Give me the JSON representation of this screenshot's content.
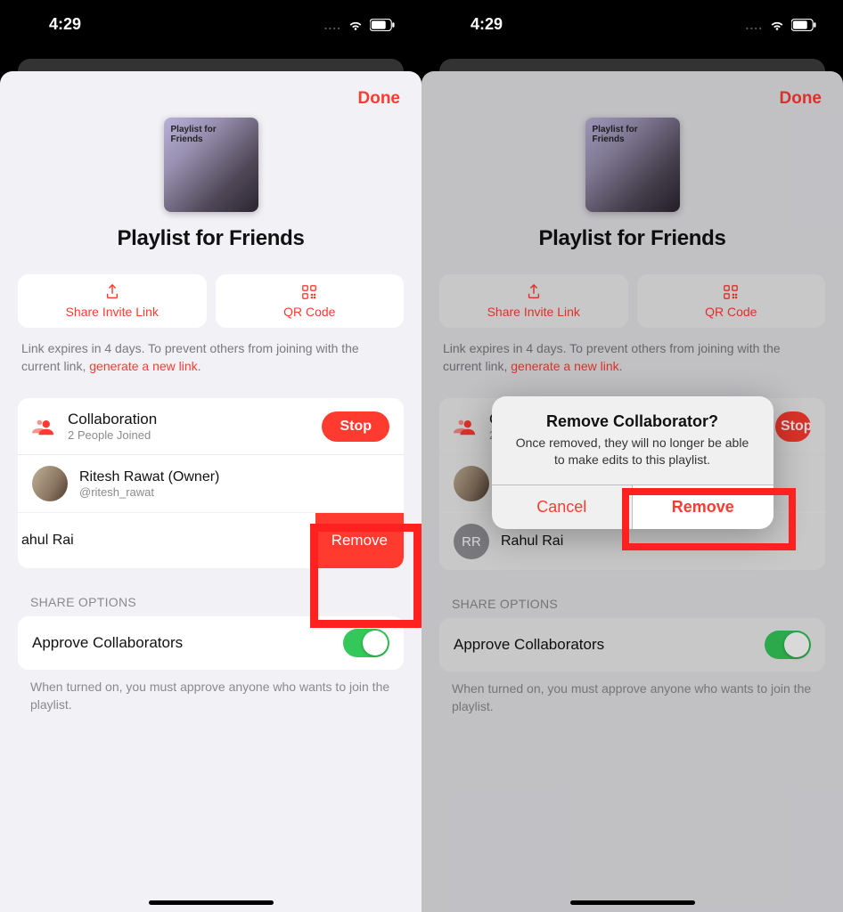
{
  "status": {
    "time": "4:29",
    "dots": "...."
  },
  "sheet": {
    "done": "Done",
    "artwork_label": "Playlist for Friends",
    "title": "Playlist for Friends",
    "share_link_label": "Share Invite Link",
    "qr_label": "QR Code",
    "help_prefix": "Link expires in 4 days. To prevent others from joining with the current link, ",
    "help_link": "generate a new link",
    "help_suffix": ".",
    "collab": {
      "title": "Collaboration",
      "subtitle": "2 People Joined",
      "stop": "Stop"
    },
    "owner": {
      "name": "Ritesh Rawat (Owner)",
      "handle": "@ritesh_rawat"
    },
    "member_swiped": {
      "name_partial": "ahul Rai",
      "remove": "Remove"
    },
    "member_full": {
      "initials": "RR",
      "name": "Rahul Rai"
    },
    "section_label": "SHARE OPTIONS",
    "toggle_label": "Approve Collaborators",
    "footer": "When turned on, you must approve anyone who wants to join the playlist."
  },
  "alert": {
    "title": "Remove Collaborator?",
    "message": "Once removed, they will no longer be able to make edits to this playlist.",
    "cancel": "Cancel",
    "confirm": "Remove"
  }
}
